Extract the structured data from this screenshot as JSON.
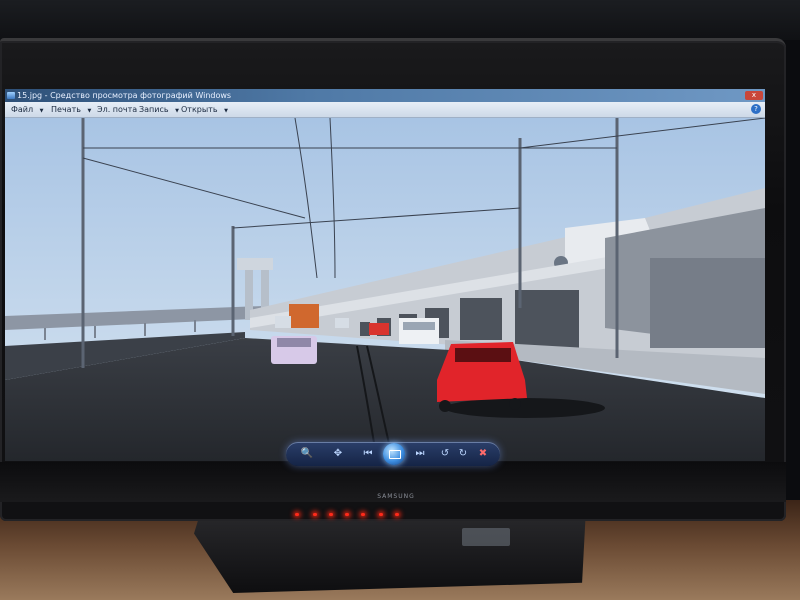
{
  "window": {
    "title": "15.jpg - Средство просмотра фотографий Windows",
    "close_glyph": "x"
  },
  "menu": {
    "items": [
      {
        "label": "Файл",
        "arrow": "▼"
      },
      {
        "label": "Печать",
        "arrow": "▼"
      },
      {
        "label": "Эл. почта",
        "arrow": ""
      },
      {
        "label": "Запись",
        "arrow": "▼"
      },
      {
        "label": "Открыть",
        "arrow": "▼"
      }
    ],
    "help_glyph": "?"
  },
  "controls": {
    "zoom": "🔍",
    "fit": "✥",
    "prev": "⏮",
    "slideshow": "slideshow-icon",
    "next": "⏭",
    "rotate_ccw": "↺",
    "rotate_cw": "↻",
    "delete": "✖"
  },
  "monitor": {
    "brand": "SAMSUNG"
  },
  "colors": {
    "title_bar": "#4f79a6",
    "menu_bar": "#dbe4f0",
    "sky": "#b9d0e8",
    "road": "#2a2d33",
    "red_car": "#e1242a",
    "led": "#ff2a1a"
  }
}
